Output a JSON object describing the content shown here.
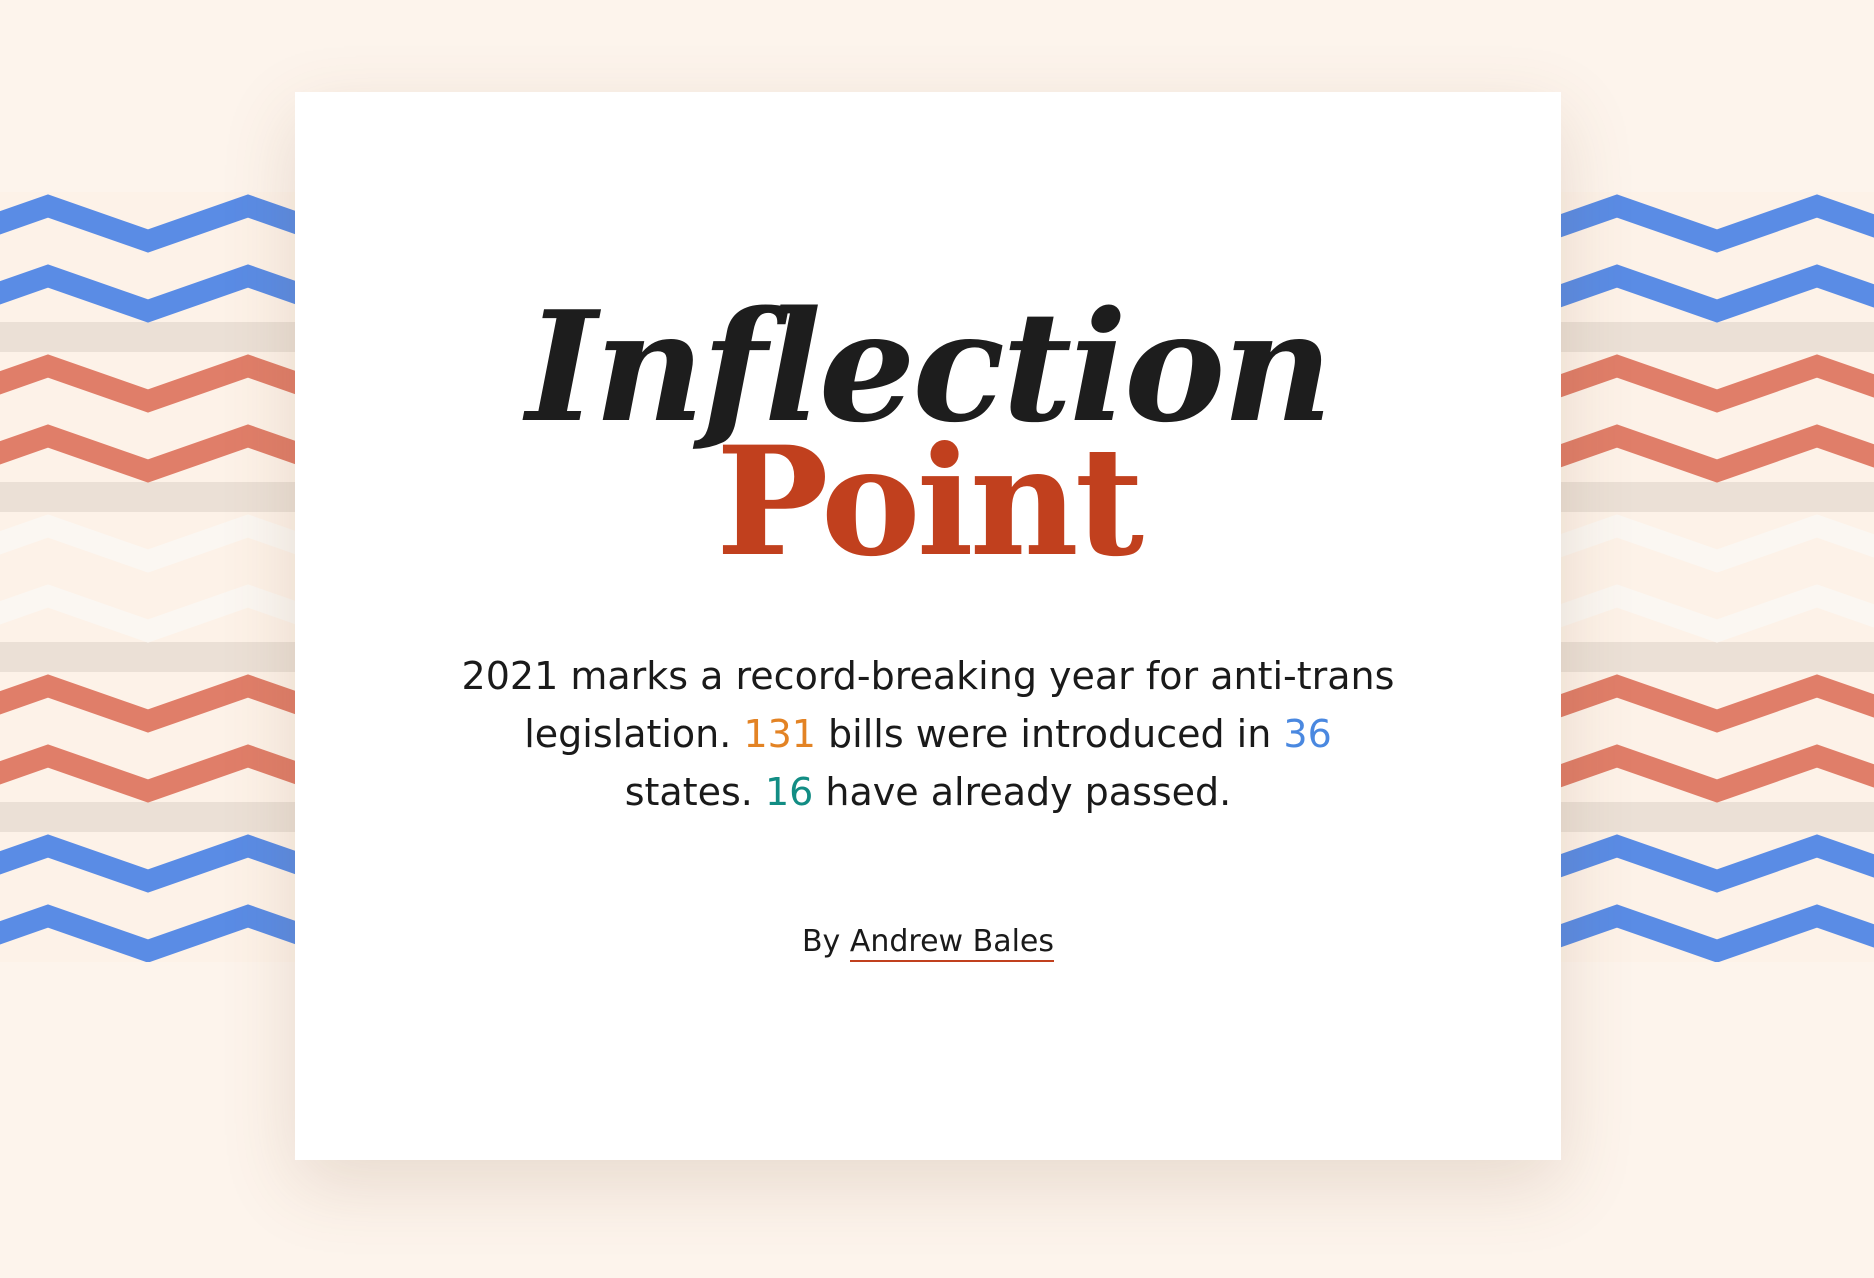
{
  "title": {
    "line1": "Inflection",
    "line2": "Point"
  },
  "intro": {
    "part1": "2021 marks a record-breaking year for anti-trans legislation. ",
    "bills_count": "131",
    "part2": " bills were introduced in ",
    "states_count": "36",
    "part3": " states. ",
    "passed_count": "16",
    "part4": " have already passed."
  },
  "byline": {
    "prefix": "By ",
    "author": "Andrew Bales"
  },
  "colors": {
    "background": "#fdf4ec",
    "title_dark": "#1d1d1d",
    "accent_red": "#c1401e",
    "bills_orange": "#e38324",
    "states_blue": "#4a88e0",
    "passed_teal": "#128d84",
    "zigzag_blue": "#5a8ce5",
    "zigzag_coral": "#e07e69",
    "zigzag_white": "#fbf7f2"
  },
  "decoration": {
    "zigzag_band_colors": [
      "zigzag_blue",
      "zigzag_coral",
      "zigzag_white",
      "zigzag_coral",
      "zigzag_blue"
    ]
  }
}
